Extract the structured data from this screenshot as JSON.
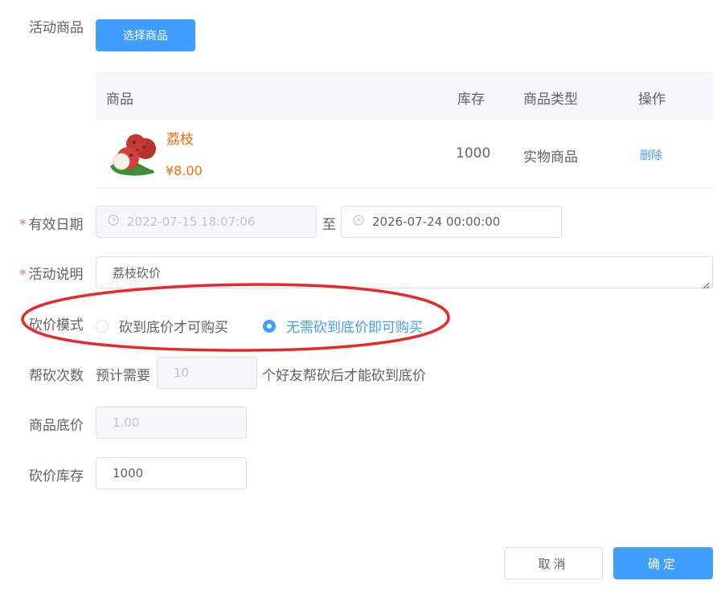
{
  "activity_goods": {
    "label": "活动商品",
    "select_button": "选择商品"
  },
  "goods_table": {
    "headers": [
      "商品",
      "库存",
      "商品类型",
      "操作"
    ],
    "rows": [
      {
        "name": "荔枝",
        "price": "¥8.00",
        "stock": "1000",
        "type": "实物商品",
        "action": "删除",
        "image_icon": "lychee-image"
      }
    ]
  },
  "valid_date": {
    "label": "有效日期",
    "start": "2022-07-15 18:07:06",
    "separator": "至",
    "end": "2026-07-24 00:00:00"
  },
  "activity_desc": {
    "label": "活动说明",
    "value": "荔枝砍价"
  },
  "bargain_mode": {
    "label": "砍价模式",
    "options": [
      {
        "label": "砍到底价才可购买",
        "checked": false
      },
      {
        "label": "无需砍到底价即可购买",
        "checked": true
      }
    ]
  },
  "help_count": {
    "label": "帮砍次数",
    "prefix": "预计需要",
    "value": "10",
    "suffix": "个好友帮砍后才能砍到底价"
  },
  "floor_price": {
    "label": "商品底价",
    "value": "1.00"
  },
  "bargain_stock": {
    "label": "砍价库存",
    "value": "1000"
  },
  "footer": {
    "cancel": "取消",
    "confirm": "确定"
  },
  "colors": {
    "primary": "#409eff",
    "price_orange": "#ff6a00",
    "required_red": "#f56c6c",
    "annotation_red": "#e8282b"
  }
}
